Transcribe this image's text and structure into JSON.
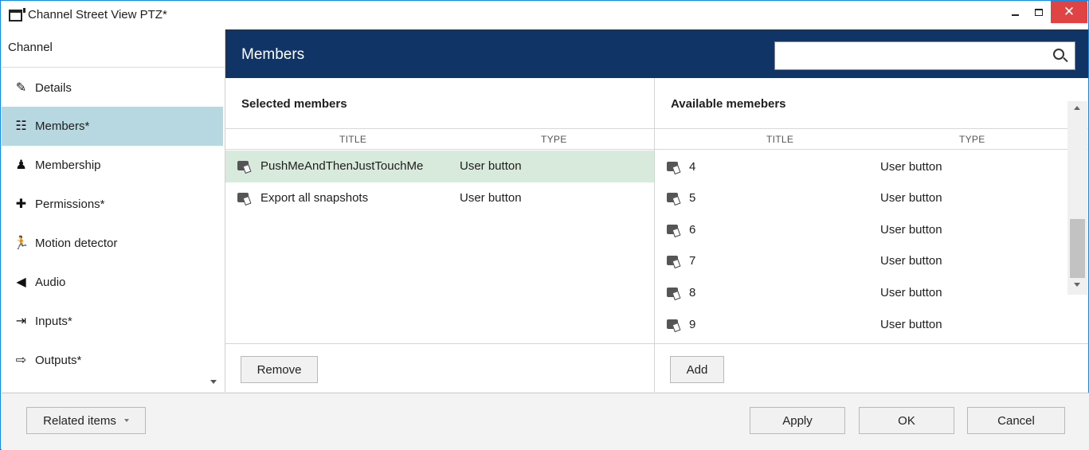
{
  "window": {
    "title": "Channel Street View PTZ*",
    "close_glyph": "✕"
  },
  "nav": {
    "header": "Channel",
    "items": [
      {
        "label": "Details",
        "icon": "pencil-icon",
        "glyph": "✎"
      },
      {
        "label": "Members*",
        "icon": "members-icon",
        "glyph": "☷"
      },
      {
        "label": "Membership",
        "icon": "membership-icon",
        "glyph": "♟"
      },
      {
        "label": "Permissions*",
        "icon": "permissions-icon",
        "glyph": "✚"
      },
      {
        "label": "Motion detector",
        "icon": "running-icon",
        "glyph": "🏃"
      },
      {
        "label": "Audio",
        "icon": "speaker-icon",
        "glyph": "◀"
      },
      {
        "label": "Inputs*",
        "icon": "input-icon",
        "glyph": "⇥"
      },
      {
        "label": "Outputs*",
        "icon": "output-icon",
        "glyph": "⇨"
      }
    ],
    "active_index": 1
  },
  "main": {
    "title": "Members",
    "search": {
      "value": "",
      "placeholder": ""
    }
  },
  "selected_members": {
    "title": "Selected members",
    "columns": [
      "TITLE",
      "TYPE"
    ],
    "rows": [
      {
        "title": "PushMeAndThenJustTouchMe",
        "type": "User button",
        "selected": true
      },
      {
        "title": "Export all snapshots",
        "type": "User button",
        "selected": false
      }
    ],
    "remove_label": "Remove"
  },
  "available_members": {
    "title": "Available memebers",
    "columns": [
      "TITLE",
      "TYPE"
    ],
    "rows": [
      {
        "title": "4",
        "type": "User button"
      },
      {
        "title": "5",
        "type": "User button"
      },
      {
        "title": "6",
        "type": "User button"
      },
      {
        "title": "7",
        "type": "User button"
      },
      {
        "title": "8",
        "type": "User button"
      },
      {
        "title": "9",
        "type": "User button"
      }
    ],
    "add_label": "Add"
  },
  "footer": {
    "related_label": "Related items",
    "apply_label": "Apply",
    "ok_label": "OK",
    "cancel_label": "Cancel"
  },
  "colors": {
    "header_bg": "#0f3465",
    "active_nav": "#b7d8e0",
    "selected_row": "#d8eadb",
    "close_button": "#e04343"
  }
}
